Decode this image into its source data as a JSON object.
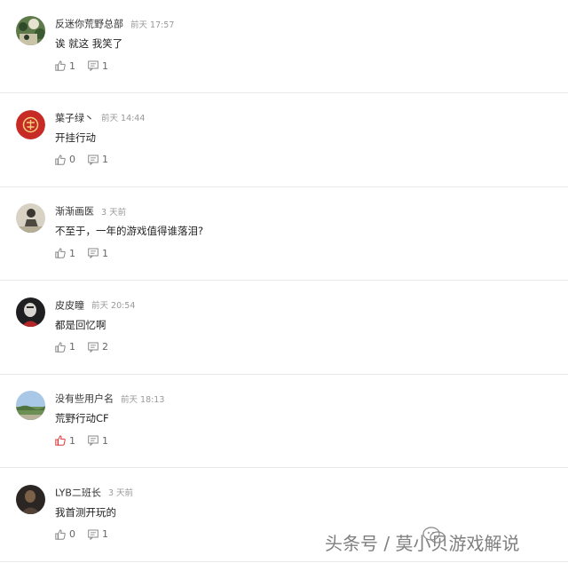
{
  "colors": {
    "like_active": "#e0393e",
    "icon": "#888888",
    "divider": "#e8e8e8"
  },
  "comments": [
    {
      "username": "反迷你荒野总部",
      "time": "前天 17:57",
      "text": "诶 就这 我笑了",
      "likes": "1",
      "replies": "1",
      "liked": false,
      "avatar": "green-crowd"
    },
    {
      "username": "葉子绿丶",
      "time": "前天 14:44",
      "text": "开挂行动",
      "likes": "0",
      "replies": "1",
      "liked": false,
      "avatar": "red-seal"
    },
    {
      "username": "渐渐画医",
      "time": "3 天前",
      "text": "不至于，一年的游戏值得谁落泪?",
      "likes": "1",
      "replies": "1",
      "liked": false,
      "avatar": "figure-light"
    },
    {
      "username": "皮皮瞳",
      "time": "前天 20:54",
      "text": "都是回忆啊",
      "likes": "1",
      "replies": "2",
      "liked": false,
      "avatar": "dark-portrait"
    },
    {
      "username": "没有些用户名",
      "time": "前天 18:13",
      "text": "荒野行动CF",
      "likes": "1",
      "replies": "1",
      "liked": true,
      "avatar": "landscape"
    },
    {
      "username": "LYB二班长",
      "time": "3 天前",
      "text": "我首测开玩的",
      "likes": "0",
      "replies": "1",
      "liked": false,
      "avatar": "dark-figure"
    }
  ],
  "watermark": {
    "text": "头条号 / 莫小贝游戏解说",
    "icon": "wechat-icon"
  }
}
